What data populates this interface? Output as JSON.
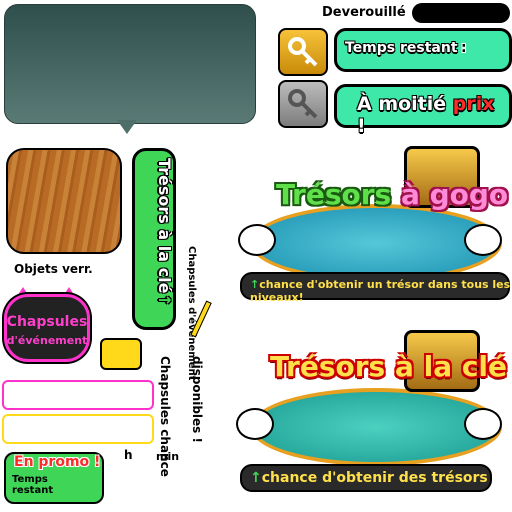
{
  "header": {
    "unlock_label": "Deverouillé",
    "time_left_label": "Temps restant",
    "time_separator": ":",
    "half_price_prefix": "À moitié ",
    "half_price_word": "prix",
    "half_price_suffix": " !"
  },
  "left_panel": {
    "objects_label": "Objets verr.",
    "event_capsules_line1": "Chapsules",
    "event_capsules_line2": "d'événement",
    "promo_label": "En promo !",
    "promo_time_label": "Temps restant",
    "hours_unit": "h",
    "minutes_unit": "min"
  },
  "vertical_tab": {
    "label": "Trésors à la clé",
    "arrow": "↑"
  },
  "vertical_texts": {
    "event_capsules": "Chapsules d'événement",
    "available": "disponibles !",
    "chance_capsules": "Chapsules chance"
  },
  "banners": [
    {
      "title_part1": "Trésors ",
      "title_part2": "à gogo",
      "arrow": "↑",
      "subtitle": "chance d'obtenir un trésor dans tous les niveaux!"
    },
    {
      "title": "Trésors à la clé",
      "arrow": "↑",
      "subtitle": "chance d'obtenir des trésors"
    }
  ],
  "colors": {
    "green_button": "#3ee8a8",
    "gold_key": "#f7c23a",
    "pink_accent": "#ff33cc",
    "yellow_accent": "#ffd91a",
    "red_text": "#ff2a2a"
  }
}
